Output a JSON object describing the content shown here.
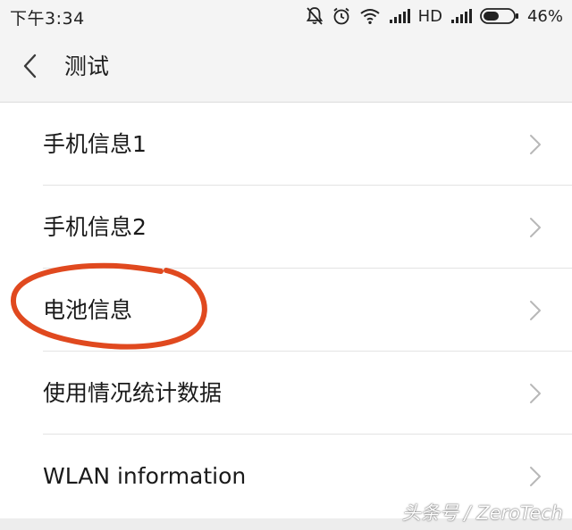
{
  "status_bar": {
    "time": "下午3:34",
    "network": "HD",
    "battery": "46%",
    "icons": [
      "mute-icon",
      "alarm-icon",
      "wifi-icon",
      "signal-icon",
      "signal-icon",
      "battery-icon"
    ]
  },
  "header": {
    "back_icon": "chevron-left-icon",
    "title": "测试"
  },
  "list": {
    "items": [
      {
        "label": "手机信息1"
      },
      {
        "label": "手机信息2"
      },
      {
        "label": "电池信息"
      },
      {
        "label": "使用情况统计数据"
      },
      {
        "label": "WLAN information"
      }
    ],
    "chevron_icon": "chevron-right-icon"
  },
  "annotation": {
    "type": "hand-drawn-ellipse",
    "color": "#e0491f",
    "target": "电池信息"
  },
  "watermark": {
    "text": "头条号 / ZeroTech"
  },
  "colors": {
    "background": "#f4f4f4",
    "list_background": "#ffffff",
    "divider": "#e3e3e3",
    "chevron": "#b8b8b8",
    "annotation": "#e0491f"
  }
}
